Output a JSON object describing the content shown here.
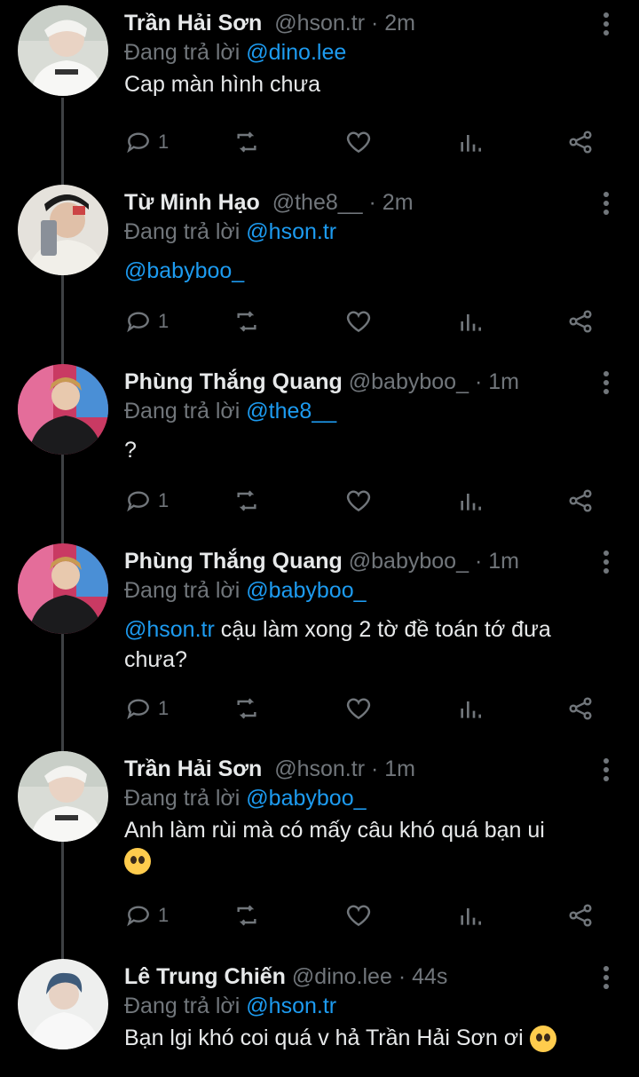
{
  "replying_prefix": "Đang trả lời",
  "tweets": [
    {
      "name": "Trần Hải Sơn",
      "handle": "@hson.tr",
      "dot": "·",
      "time": "2m",
      "reply_to": "@dino.lee",
      "mention": "",
      "text": "Cap màn hình chưa",
      "emoji": "",
      "replies": "1",
      "avatar_icon": "avatar-tran-hai-son"
    },
    {
      "name": "Từ Minh Hạo",
      "handle": "@the8__",
      "dot": "·",
      "time": "2m",
      "reply_to": "@hson.tr",
      "mention": "@babyboo_",
      "text": "",
      "emoji": "",
      "replies": "1",
      "avatar_icon": "avatar-tu-minh-hao"
    },
    {
      "name": "Phùng Thắng Quang",
      "handle": "@babyboo_",
      "dot": "·",
      "time": "1m",
      "reply_to": "@the8__",
      "mention": "",
      "text": "?",
      "emoji": "",
      "replies": "1",
      "avatar_icon": "avatar-phung-thang-quang"
    },
    {
      "name": "Phùng Thắng Quang",
      "handle": "@babyboo_",
      "dot": "·",
      "time": "1m",
      "reply_to": "@babyboo_",
      "mention": "@hson.tr",
      "text": " cậu làm xong 2 tờ đề toán tớ đưa chưa?",
      "emoji": "",
      "replies": "1",
      "avatar_icon": "avatar-phung-thang-quang"
    },
    {
      "name": "Trần Hải Sơn",
      "handle": "@hson.tr",
      "dot": "·",
      "time": "1m",
      "reply_to": "@babyboo_",
      "mention": "",
      "text": "Anh làm rùi mà có mấy câu khó quá bạn ui",
      "emoji": "pleading-face",
      "replies": "1",
      "avatar_icon": "avatar-tran-hai-son"
    },
    {
      "name": "Lê Trung Chiến",
      "handle": "@dino.lee",
      "dot": "·",
      "time": "44s",
      "reply_to": "@hson.tr",
      "mention": "",
      "text": "Bạn lgi khó coi quá v hả Trần Hải Sơn ơi",
      "emoji": "smiling-face-with-hearts",
      "replies": "",
      "avatar_icon": "avatar-le-trung-chien"
    }
  ],
  "colors": {
    "background": "#000000",
    "text": "#e7e9ea",
    "muted": "#71767b",
    "accent": "#1d9bf0",
    "thread_line": "#3e4144"
  }
}
